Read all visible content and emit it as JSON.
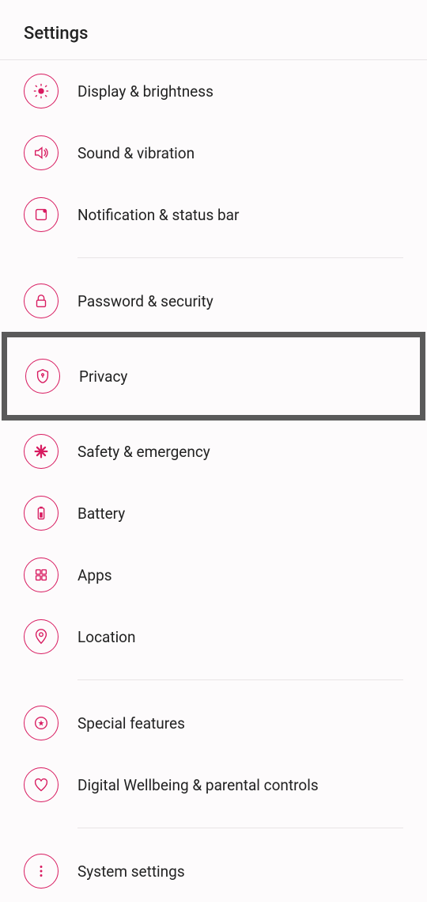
{
  "header": {
    "title": "Settings"
  },
  "items": [
    {
      "label": "Display & brightness",
      "icon": "brightness"
    },
    {
      "label": "Sound & vibration",
      "icon": "sound"
    },
    {
      "label": "Notification & status bar",
      "icon": "notification"
    },
    {
      "label": "Password & security",
      "icon": "lock"
    },
    {
      "label": "Privacy",
      "icon": "shield"
    },
    {
      "label": "Safety & emergency",
      "icon": "medical"
    },
    {
      "label": "Battery",
      "icon": "battery"
    },
    {
      "label": "Apps",
      "icon": "apps"
    },
    {
      "label": "Location",
      "icon": "location"
    },
    {
      "label": "Special features",
      "icon": "star"
    },
    {
      "label": "Digital Wellbeing & parental controls",
      "icon": "heart"
    },
    {
      "label": "System settings",
      "icon": "more"
    }
  ],
  "highlighted_index": 4,
  "colors": {
    "accent": "#d81b60",
    "text": "#222",
    "divider": "#e8e4e6",
    "highlight_border": "#5a5a5a"
  }
}
